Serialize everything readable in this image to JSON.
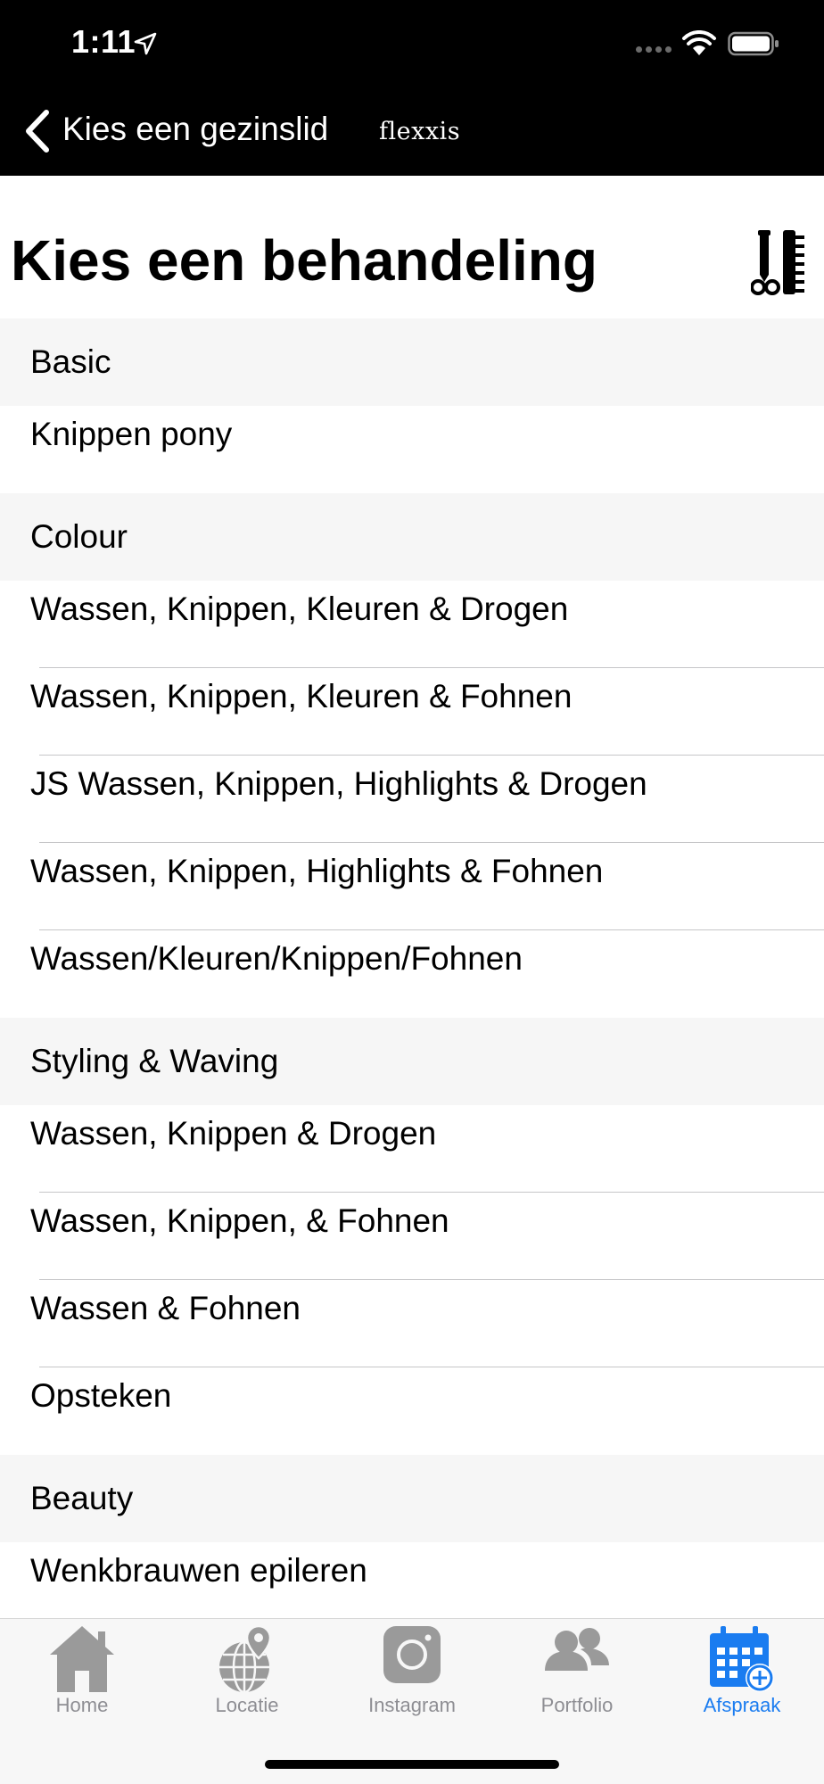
{
  "status_bar": {
    "time": "1:11"
  },
  "nav": {
    "back_label": "Kies een gezinslid",
    "logo_text": "flexxis"
  },
  "page": {
    "title": "Kies een behandeling",
    "title_icon": "hairdresser-tools-icon"
  },
  "sections": [
    {
      "header": "Basic",
      "items": [
        "Knippen pony"
      ]
    },
    {
      "header": "Colour",
      "items": [
        "Wassen, Knippen, Kleuren & Drogen",
        "Wassen, Knippen, Kleuren & Fohnen",
        "JS Wassen, Knippen, Highlights & Drogen",
        "Wassen, Knippen, Highlights & Fohnen",
        "Wassen/Kleuren/Knippen/Fohnen"
      ]
    },
    {
      "header": "Styling & Waving",
      "items": [
        "Wassen, Knippen & Drogen",
        "Wassen, Knippen, & Fohnen",
        "Wassen & Fohnen",
        "Opsteken"
      ]
    },
    {
      "header": "Beauty",
      "items": [
        "Wenkbrauwen epileren"
      ]
    }
  ],
  "tabbar": {
    "tabs": [
      {
        "label": "Home",
        "icon": "home-icon",
        "active": false
      },
      {
        "label": "Locatie",
        "icon": "globe-pin-icon",
        "active": false
      },
      {
        "label": "Instagram",
        "icon": "instagram-icon",
        "active": false
      },
      {
        "label": "Portfolio",
        "icon": "people-icon",
        "active": false
      },
      {
        "label": "Afspraak",
        "icon": "calendar-add-icon",
        "active": true
      }
    ]
  },
  "colors": {
    "active_tab": "#1a7cf0",
    "inactive_tab": "#8e8e93",
    "header_bg": "#000000",
    "section_bg": "#f6f6f6"
  }
}
